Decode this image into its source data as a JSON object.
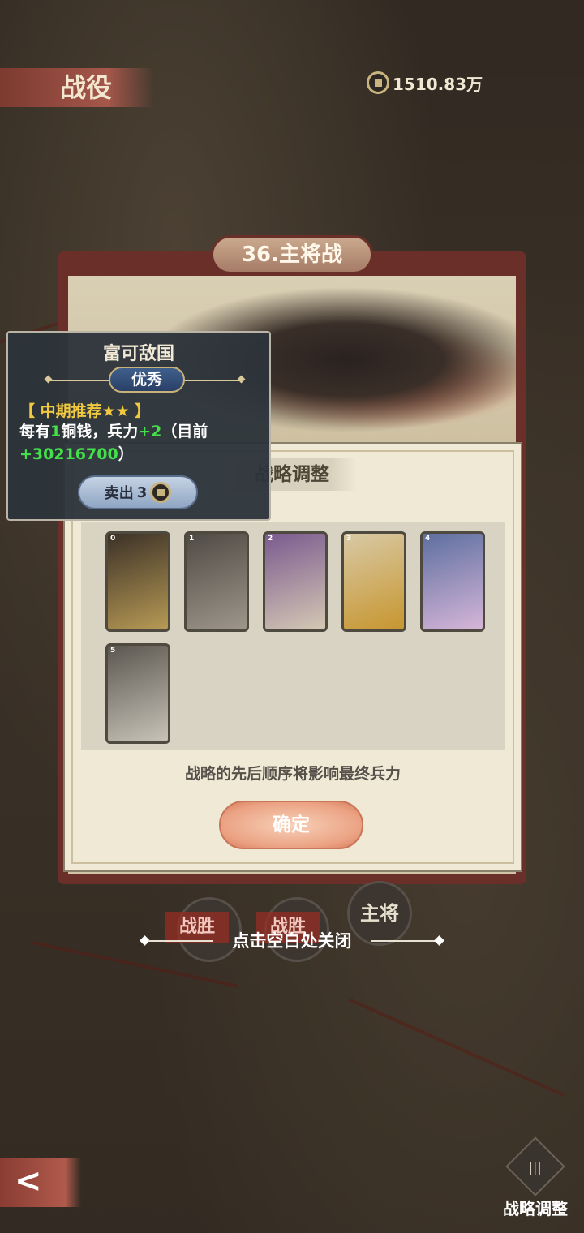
{
  "header": {
    "title": "战役",
    "coins": "1510.83万"
  },
  "battle": {
    "title": "36.主将战"
  },
  "strategy": {
    "title": "战略调整",
    "cards": [
      {
        "index": "0",
        "name": "gold-coins-card",
        "colors": [
          "#3b3127",
          "#b89a55"
        ]
      },
      {
        "index": "1",
        "name": "army-cavalry-card",
        "colors": [
          "#4f4a44",
          "#9e968b"
        ]
      },
      {
        "index": "2",
        "name": "general-portrait-card",
        "colors": [
          "#7b5a8f",
          "#d4c8b4"
        ]
      },
      {
        "index": "3",
        "name": "gold-ingots-card",
        "colors": [
          "#d8c9a5",
          "#c7962f"
        ]
      },
      {
        "index": "4",
        "name": "two-generals-card",
        "colors": [
          "#5d6fa0",
          "#d6b6d8"
        ]
      },
      {
        "index": "5",
        "name": "ink-warriors-card",
        "colors": [
          "#5b5750",
          "#c8c3b8"
        ]
      }
    ],
    "hint": "战略的先后顺序将影响最终兵力",
    "confirm_label": "确定"
  },
  "tooltip": {
    "name": "富可敌国",
    "rank": "优秀",
    "recommend": "【 中期推荐★★ 】",
    "desc_prefix": "每有",
    "desc_num1": "1",
    "desc_mid": "铜钱，兵力",
    "desc_plus": "+2",
    "desc_mid2": "（目前",
    "desc_total": "+30216700",
    "desc_suffix": "）",
    "sell_label": "卖出",
    "sell_price": "3"
  },
  "bottom": {
    "seal_labels": [
      "战胜",
      "战胜",
      "主将"
    ],
    "close_hint": "点击空白处关闭",
    "back_label": "<",
    "strategy_adjust_label": "战略调整"
  }
}
